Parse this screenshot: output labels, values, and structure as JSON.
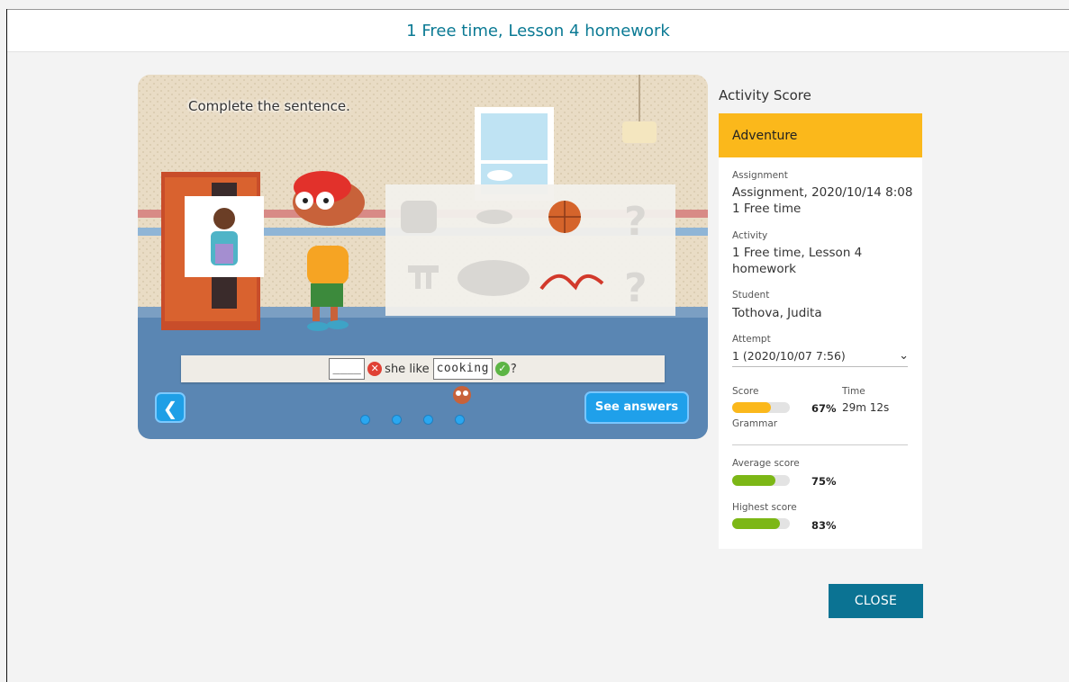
{
  "header": {
    "title": "1 Free time, Lesson 4 homework"
  },
  "activity": {
    "instruction": "Complete the sentence.",
    "sentence": {
      "blank": "____",
      "middle_text": "she like",
      "answer": "cooking",
      "end_punct": "?"
    },
    "buttons": {
      "back_icon": "chevron-left-icon",
      "see_answers": "See answers"
    },
    "page_dots": 4
  },
  "score_panel": {
    "heading": "Activity Score",
    "category": "Adventure",
    "assignment_label": "Assignment",
    "assignment_value_1": "Assignment, 2020/10/14 8:08",
    "assignment_value_2": "1 Free time",
    "activity_label": "Activity",
    "activity_value_1": "1 Free time, Lesson 4",
    "activity_value_2": "homework",
    "student_label": "Student",
    "student_value": "Tothova, Judita",
    "attempt_label": "Attempt",
    "attempt_value": "1 (2020/10/07 7:56)",
    "score_label": "Score",
    "time_label": "Time",
    "score_pct": "67%",
    "time_value": "29m 12s",
    "score_sub": "Grammar",
    "average_label": "Average score",
    "average_pct": "75%",
    "highest_label": "Highest score",
    "highest_pct": "83%",
    "colors": {
      "score_bar": "#fbb81b",
      "avg_bar": "#7cb716",
      "high_bar": "#7cb716"
    },
    "levels": {
      "score": 0.67,
      "average": 0.75,
      "highest": 0.83
    }
  },
  "footer": {
    "close_label": "CLOSE"
  }
}
